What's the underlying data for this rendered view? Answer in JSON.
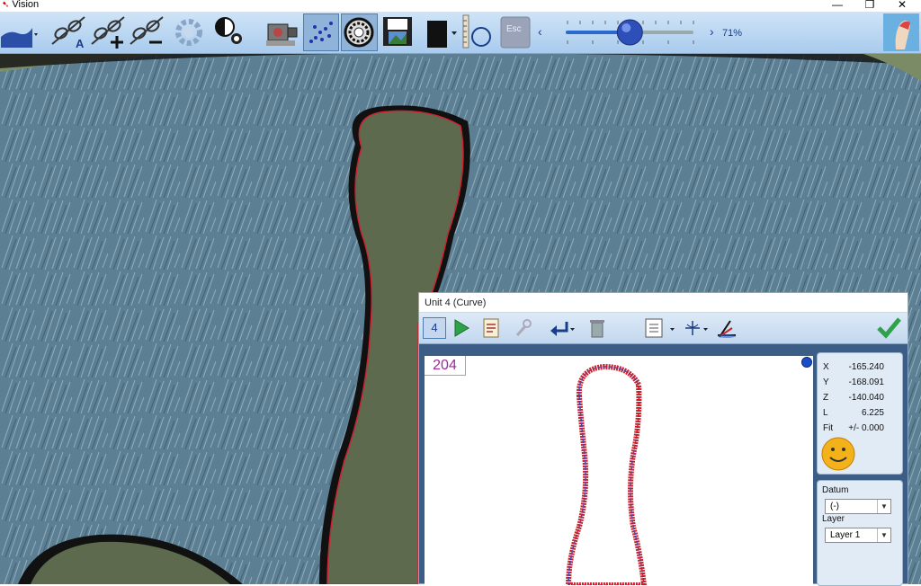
{
  "window": {
    "title": "Vision",
    "minimize_glyph": "—",
    "restore_glyph": "❐",
    "close_glyph": "✕"
  },
  "toolbar": {
    "zoom_percent": "71%",
    "zoom_slider_value": 0.71,
    "tools": [
      "profile-icon",
      "fit-auto-icon",
      "fit-add-icon",
      "fit-remove-icon",
      "settings-gear-icon",
      "light-settings-icon",
      "camera-icon",
      "point-cloud-icon",
      "ring-light-icon",
      "save-image-icon",
      "display-mode-icon",
      "circle-tool-icon",
      "escape-icon"
    ],
    "esc_label": "Esc",
    "accent": "#1a3d8a"
  },
  "dialog": {
    "title": "Unit 4 (Curve)",
    "unit_number": "4",
    "point_count": "204",
    "readout": [
      {
        "key": "X",
        "value": "-165.240"
      },
      {
        "key": "Y",
        "value": "-168.091"
      },
      {
        "key": "Z",
        "value": "-140.040"
      },
      {
        "key": "L",
        "value": "6.225"
      },
      {
        "key": "Fit",
        "value": "+/- 0.000"
      }
    ],
    "datum_label": "Datum",
    "datum_value": "(-)",
    "layer_label": "Layer",
    "layer_value": "Layer 1",
    "curve_color": "#d0202a",
    "points_color": "#3a3aa8"
  }
}
